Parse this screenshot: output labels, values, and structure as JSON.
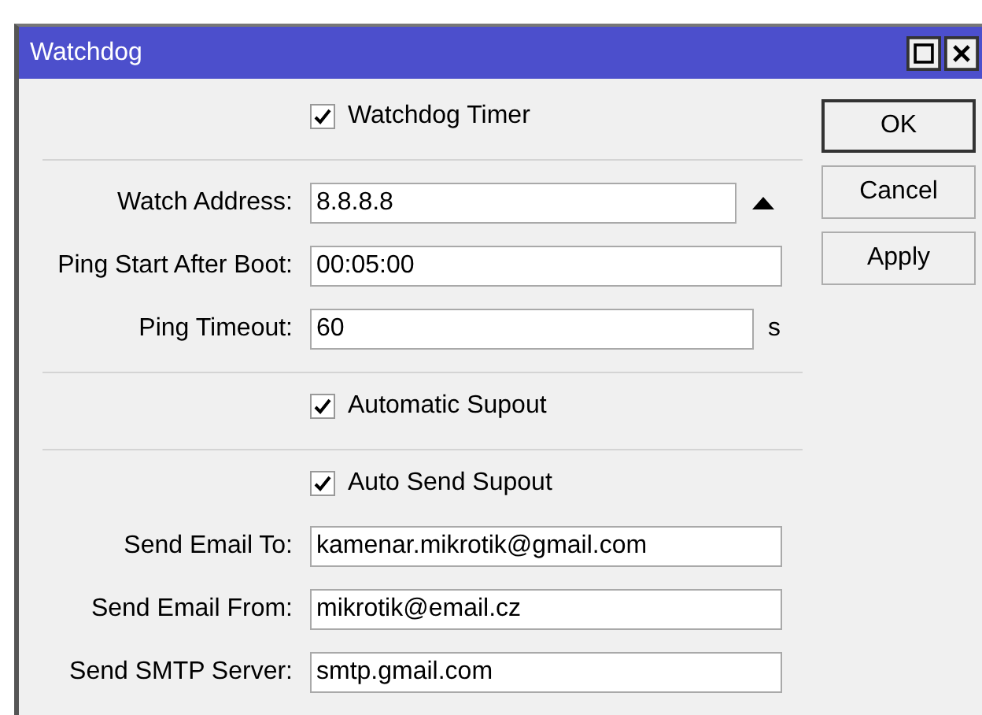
{
  "window": {
    "title": "Watchdog"
  },
  "rows": [
    {
      "kind": "checkbox",
      "label": "Watchdog Timer",
      "checked": true
    },
    {
      "kind": "separator"
    },
    {
      "kind": "dropdown-field",
      "label": "Watch Address:",
      "value": "8.8.8.8"
    },
    {
      "kind": "field",
      "label": "Ping Start After Boot:",
      "value": "00:05:00"
    },
    {
      "kind": "unit-field",
      "label": "Ping Timeout:",
      "value": "60",
      "unit": "s"
    },
    {
      "kind": "separator"
    },
    {
      "kind": "checkbox",
      "label": "Automatic Supout",
      "checked": true
    },
    {
      "kind": "separator"
    },
    {
      "kind": "checkbox",
      "label": "Auto Send Supout",
      "checked": true
    },
    {
      "kind": "field",
      "label": "Send Email To:",
      "value": "kamenar.mikrotik@gmail.com"
    },
    {
      "kind": "field",
      "label": "Send Email From:",
      "value": "mikrotik@email.cz"
    },
    {
      "kind": "field",
      "label": "Send SMTP Server:",
      "value": "smtp.gmail.com"
    }
  ],
  "buttons": [
    {
      "label": "OK",
      "default": true
    },
    {
      "label": "Cancel",
      "default": false
    },
    {
      "label": "Apply",
      "default": false
    }
  ]
}
